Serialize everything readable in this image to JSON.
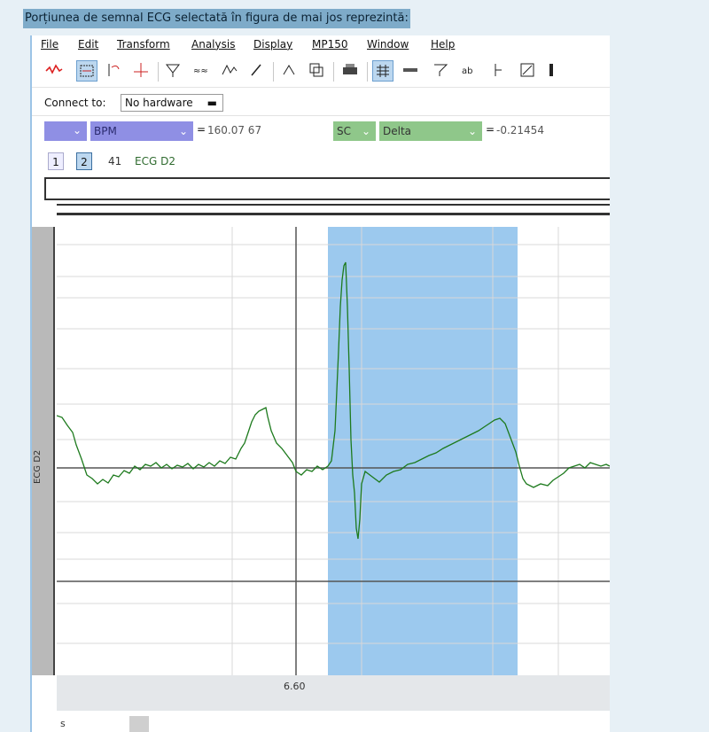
{
  "question": {
    "text": "Porțiunea de semnal ECG selectată în figura de mai jos reprezintă:"
  },
  "menu": [
    {
      "label": "File"
    },
    {
      "label": "Edit"
    },
    {
      "label": "Transform"
    },
    {
      "label": "Analysis"
    },
    {
      "label": "Display"
    },
    {
      "label": "MP150"
    },
    {
      "label": "Window"
    },
    {
      "label": "Help"
    }
  ],
  "toolbar": {
    "icons": [
      "red-waveform-icon",
      "zoom-icon",
      "select-icon",
      "cursor-icon",
      "filter-icon",
      "resample-icon",
      "peak-icon",
      "pen-icon",
      "autoscale-icon",
      "overlap-icon",
      "print-icon",
      "grid-icon",
      "scroll-icon",
      "scale-icon",
      "marker-icon",
      "arrow-icon",
      "window-icon"
    ]
  },
  "connect": {
    "label": "Connect to:",
    "value": "No hardware"
  },
  "measurements": [
    {
      "channel": "",
      "function": "BPM",
      "equals": "=",
      "value": "160.07 67",
      "color": "#8f8fe4"
    },
    {
      "channel": "SC",
      "function": "Delta",
      "equals": "=",
      "value": "-0.21454",
      "color": "#8fc78a"
    }
  ],
  "channels": {
    "buttons": [
      "1",
      "2"
    ],
    "active": "2",
    "number": "41",
    "name": "ECG D2"
  },
  "graph": {
    "y_label": "ECG D2",
    "x_tick": "6.60",
    "x_unit": "s",
    "line_color": "#1d7a1d",
    "selection_color": "#9cc9ee"
  }
}
